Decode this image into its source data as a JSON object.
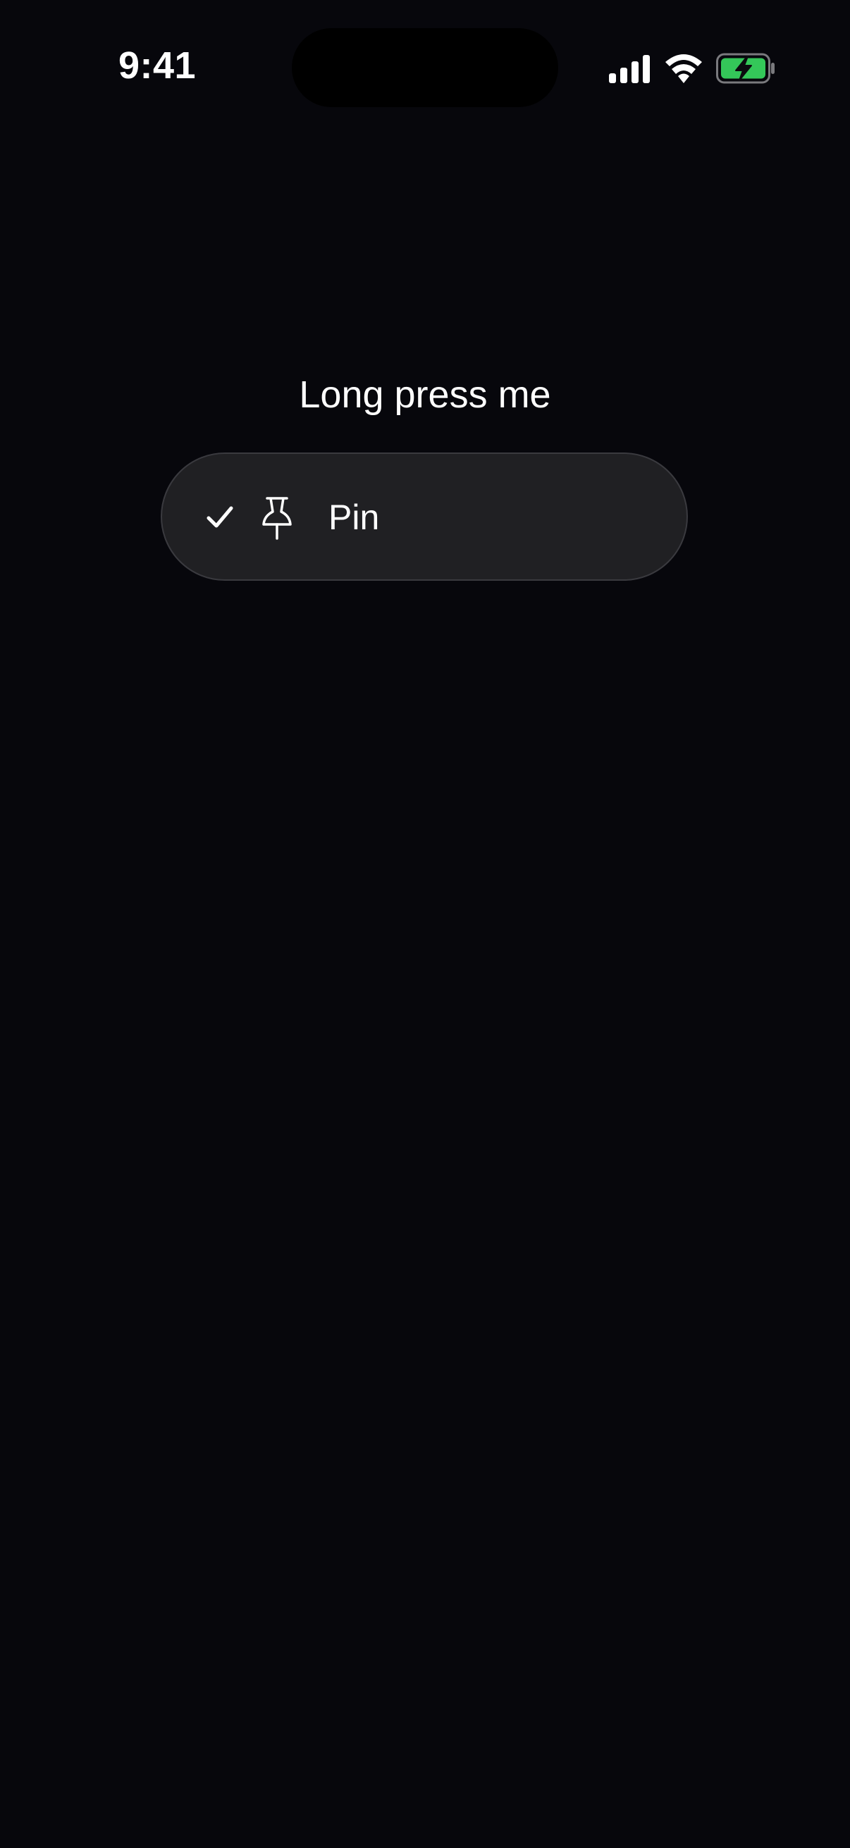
{
  "status_bar": {
    "time": "9:41",
    "icons": [
      "signal-icon",
      "wifi-icon",
      "battery-charging-icon"
    ],
    "battery_color": "#34c759"
  },
  "main": {
    "label": "Long press me"
  },
  "context_menu": {
    "items": [
      {
        "label": "Pin",
        "icon": "pin-icon",
        "checked": true,
        "check_icon": "checkmark-icon"
      }
    ]
  },
  "colors": {
    "background": "#07070c",
    "menu_background": "#202023",
    "text": "#ffffff"
  }
}
